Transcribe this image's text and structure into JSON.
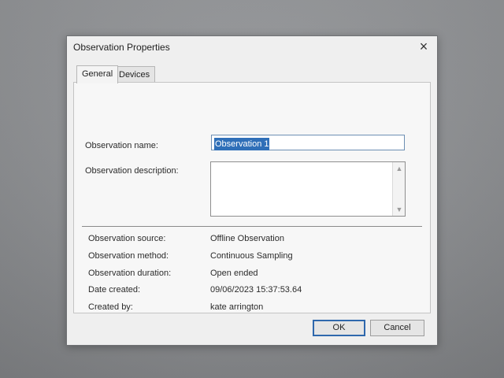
{
  "dialog": {
    "title": "Observation Properties",
    "close_symbol": "×",
    "tabs": [
      {
        "label": "General"
      },
      {
        "label": "Devices"
      }
    ],
    "fields": {
      "name_label": "Observation name:",
      "name_value": "Observation 1",
      "description_label": "Observation description:",
      "description_value": ""
    },
    "details": [
      {
        "label": "Observation source:",
        "value": "Offline Observation"
      },
      {
        "label": "Observation method:",
        "value": "Continuous Sampling"
      },
      {
        "label": "Observation duration:",
        "value": "Open ended"
      },
      {
        "label": "Date created:",
        "value": "09/06/2023 15:37:53.64"
      },
      {
        "label": "Created by:",
        "value": "kate arrington"
      }
    ],
    "buttons": {
      "ok_label": "OK",
      "cancel_label": "Cancel"
    },
    "icons": {
      "scroll_up": "▲",
      "scroll_down": "▼"
    }
  }
}
